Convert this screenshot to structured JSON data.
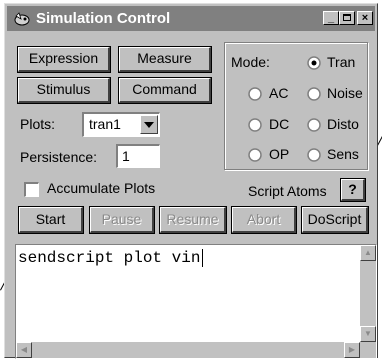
{
  "window": {
    "title": "Simulation Control"
  },
  "buttons": {
    "expression": "Expression",
    "measure": "Measure",
    "stimulus": "Stimulus",
    "command": "Command",
    "start": "Start",
    "pause": "Pause",
    "resume": "Resume",
    "abort": "Abort",
    "doscript": "DoScript"
  },
  "plots": {
    "label": "Plots:",
    "selected": "tran1"
  },
  "persistence": {
    "label": "Persistence:",
    "value": "1"
  },
  "accumulate": {
    "label": "Accumulate Plots",
    "checked": false
  },
  "mode": {
    "label": "Mode:",
    "selected": "Tran",
    "options": [
      "Tran",
      "AC",
      "Noise",
      "DC",
      "Disto",
      "OP",
      "Sens"
    ]
  },
  "script_atoms": {
    "label": "Script Atoms",
    "icon": "?"
  },
  "script": {
    "text": "sendscript plot vin"
  }
}
